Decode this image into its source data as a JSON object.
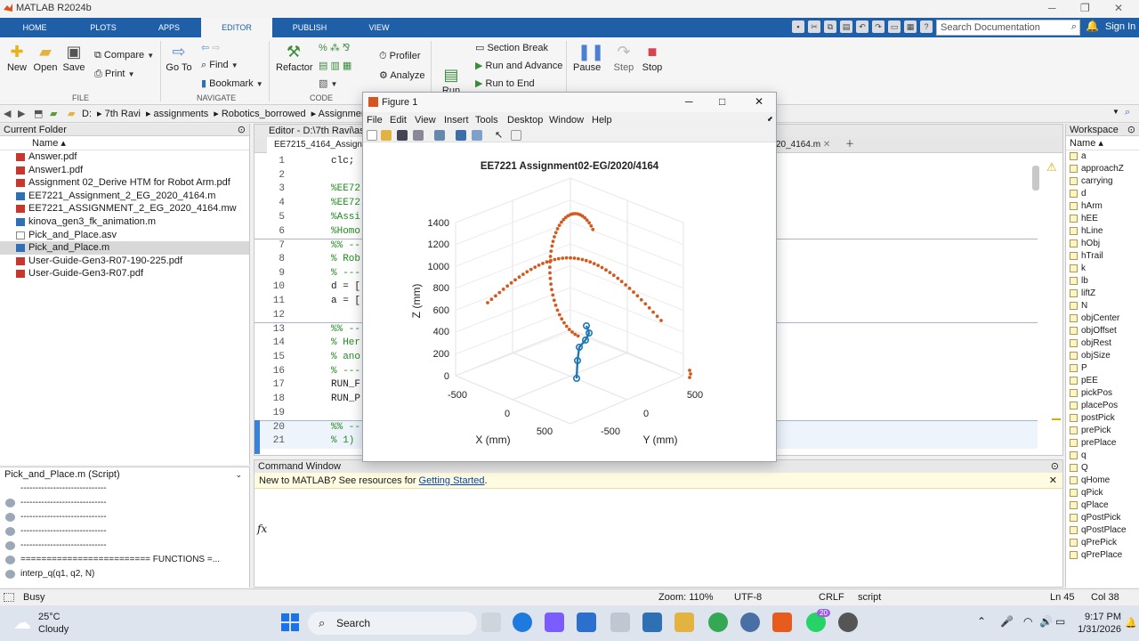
{
  "app": {
    "title": "MATLAB R2024b",
    "search_placeholder": "Search Documentation",
    "sign_in": "Sign In"
  },
  "tabs": [
    "HOME",
    "PLOTS",
    "APPS",
    "EDITOR",
    "PUBLISH",
    "VIEW"
  ],
  "ribbon": {
    "new": "New",
    "open": "Open",
    "save": "Save",
    "compare": "Compare",
    "print": "Print",
    "goto": "Go To",
    "find": "Find",
    "bookmark": "Bookmark",
    "refactor": "Refactor",
    "profiler": "Profiler",
    "analyze": "Analyze",
    "run_section": "Run\nSection",
    "section_break": "Section Break",
    "run_advance": "Run and Advance",
    "run_to_end": "Run to End",
    "pause": "Pause",
    "step": "Step",
    "stop": "Stop",
    "groups": [
      "FILE",
      "NAVIGATE",
      "CODE"
    ]
  },
  "address": [
    "D:",
    "7th Ravi",
    "assignments",
    "Robotics_borrowed",
    "Assignmen"
  ],
  "current_folder": {
    "title": "Current Folder",
    "column": "Name",
    "files": [
      {
        "name": "Answer.pdf",
        "type": "pdf"
      },
      {
        "name": "Answer1.pdf",
        "type": "pdf"
      },
      {
        "name": "Assignment 02_Derive HTM for Robot Arm.pdf",
        "type": "pdf"
      },
      {
        "name": "EE7221_Assignment_2_EG_2020_4164.m",
        "type": "m"
      },
      {
        "name": "EE7221_ASSIGNMENT_2_EG_2020_4164.mw",
        "type": "mw"
      },
      {
        "name": "kinova_gen3_fk_animation.m",
        "type": "m"
      },
      {
        "name": "Pick_and_Place.asv",
        "type": "asv"
      },
      {
        "name": "Pick_and_Place.m",
        "type": "m",
        "selected": true
      },
      {
        "name": "User-Guide-Gen3-R07-190-225.pdf",
        "type": "pdf"
      },
      {
        "name": "User-Guide-Gen3-R07.pdf",
        "type": "pdf"
      }
    ]
  },
  "details": {
    "title": "Pick_and_Place.m  (Script)",
    "lines": [
      "-----------------------------",
      "-----------------------------",
      "-----------------------------",
      "-----------------------------",
      "-----------------------------",
      "========================= FUNCTIONS =...",
      "interp_q(q1, q2, N)"
    ]
  },
  "editor": {
    "header": "Editor - D:\\7th Ravi\\ass",
    "tab_left": "EE7215_4164_Assignm",
    "tab_right": "20_4164.m",
    "lines": [
      {
        "n": "1",
        "t": "clc;",
        "c": false
      },
      {
        "n": "2",
        "t": "",
        "c": false
      },
      {
        "n": "3",
        "t": "%EE72",
        "c": true
      },
      {
        "n": "4",
        "t": "%EE72",
        "c": true
      },
      {
        "n": "5",
        "t": "%Assi",
        "c": true
      },
      {
        "n": "6",
        "t": "%Homo",
        "c": true
      },
      {
        "n": "7",
        "t": "%% --",
        "c": true
      },
      {
        "n": "8",
        "t": "% Rob",
        "c": true
      },
      {
        "n": "9",
        "t": "% ---",
        "c": true
      },
      {
        "n": "10",
        "t": "d = [",
        "c": false
      },
      {
        "n": "11",
        "t": "a = [",
        "c": false
      },
      {
        "n": "12",
        "t": "",
        "c": false
      },
      {
        "n": "13",
        "t": "%% --",
        "c": true
      },
      {
        "n": "14",
        "t": "% Her",
        "c": true
      },
      {
        "n": "15",
        "t": "% ano",
        "c": true
      },
      {
        "n": "16",
        "t": "% ---",
        "c": true
      },
      {
        "n": "17",
        "t": "RUN_F",
        "c": false
      },
      {
        "n": "18",
        "t": "RUN_P",
        "c": false
      },
      {
        "n": "19",
        "t": "",
        "c": false
      },
      {
        "n": "20",
        "t": "%% --",
        "c": true
      },
      {
        "n": "21",
        "t": "% 1)",
        "c": true
      }
    ]
  },
  "command_window": {
    "title": "Command Window",
    "banner_text": "New to MATLAB? See resources for ",
    "banner_link": "Getting Started",
    "banner_end": ".",
    "prompt": "fx"
  },
  "workspace": {
    "title": "Workspace",
    "column": "Name",
    "vars": [
      "a",
      "approachZ",
      "carrying",
      "d",
      "hArm",
      "hEE",
      "hLine",
      "hObj",
      "hTrail",
      "k",
      "lb",
      "liftZ",
      "N",
      "objCenter",
      "objOffset",
      "objRest",
      "objSize",
      "P",
      "pEE",
      "pickPos",
      "placePos",
      "postPick",
      "prePick",
      "prePlace",
      "q",
      "Q",
      "qHome",
      "qPick",
      "qPlace",
      "qPostPick",
      "qPostPlace",
      "qPrePick",
      "qPrePlace"
    ]
  },
  "status": {
    "busy": "Busy",
    "zoom": "Zoom: 110%",
    "encoding": "UTF-8",
    "eol": "CRLF",
    "type": "script",
    "ln": "Ln  45",
    "col": "Col  38"
  },
  "taskbar": {
    "temp": "25°C",
    "weather": "Cloudy",
    "search": "Search",
    "time": "9:17 PM",
    "date": "1/31/2026",
    "badge": "20"
  },
  "figure": {
    "title": "Figure 1",
    "menu": [
      "File",
      "Edit",
      "View",
      "Insert",
      "Tools",
      "Desktop",
      "Window",
      "Help"
    ]
  },
  "chart_data": {
    "type": "scatter",
    "title": "EE7221 Assignment02-EG/2020/4164",
    "xlabel": "X (mm)",
    "ylabel": "Y (mm)",
    "zlabel": "Z (mm)",
    "z_ticks": [
      "1400",
      "1200",
      "1000",
      "800",
      "600",
      "400",
      "200",
      "0"
    ],
    "x_ticks": [
      "-500",
      "0",
      "500"
    ],
    "y_ticks": [
      "500",
      "0",
      "-500"
    ],
    "grid": true,
    "trail_color": "#d35a1f",
    "arm_color": "#1f77b4"
  }
}
